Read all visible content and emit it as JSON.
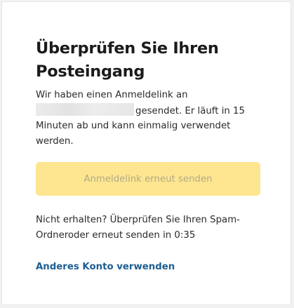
{
  "card": {
    "title_line1": "Überprüfen Sie Ihren",
    "title_line2": "Posteingang",
    "description_prefix": "Wir haben einen Anmeldelink an",
    "description_suffix": "gesendet. Er läuft in 15 Minuten ab und kann einmalig verwendet werden.",
    "resend_button_label": "Anmeldelink erneut senden",
    "hint_text": "Nicht erhalten? Überprüfen Sie Ihren Spam-Ordneroder erneut senden in 0:35",
    "switch_account_label": "Anderes Konto verwenden"
  },
  "colors": {
    "button_background": "#fde68f",
    "button_text": "#b3a989",
    "link": "#1d5e93",
    "text": "#2a2a2a"
  }
}
